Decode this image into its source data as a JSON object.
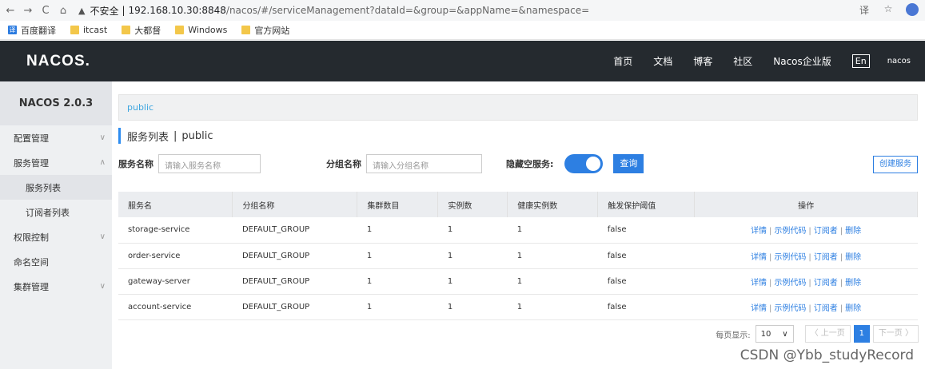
{
  "browser": {
    "nav_back": "←",
    "nav_forward": "→",
    "nav_reload": "C",
    "nav_home": "⌂",
    "warn_icon": "▲",
    "insecure": "不安全",
    "sep": "|",
    "host": "192.168.10.30:8848",
    "path": "/nacos/#/serviceManagement?dataId=&group=&appName=&namespace=",
    "translate_icon": "译",
    "star_icon": "☆"
  },
  "bookmarks": [
    {
      "label": "百度翻译",
      "icon": "translate",
      "glyph": "译"
    },
    {
      "label": "itcast",
      "icon": "folder",
      "glyph": ""
    },
    {
      "label": "大都督",
      "icon": "folder",
      "glyph": ""
    },
    {
      "label": "Windows",
      "icon": "folder",
      "glyph": ""
    },
    {
      "label": "官方网站",
      "icon": "folder",
      "glyph": ""
    }
  ],
  "topnav": {
    "logo": "NACOS.",
    "links": [
      "首页",
      "文档",
      "博客",
      "社区",
      "Nacos企业版"
    ],
    "lang": "En",
    "user": "nacos"
  },
  "sidebar": {
    "version": "NACOS 2.0.3",
    "items": [
      {
        "label": "配置管理",
        "chev": "∨"
      },
      {
        "label": "服务管理",
        "chev": "∧"
      },
      {
        "label": "权限控制",
        "chev": "∨"
      },
      {
        "label": "命名空间",
        "chev": ""
      },
      {
        "label": "集群管理",
        "chev": "∨"
      }
    ],
    "subitems": [
      "服务列表",
      "订阅者列表"
    ]
  },
  "main": {
    "namespace_tab": "public",
    "title": "服务列表",
    "title_sep": "|",
    "title_ns": "public",
    "filters": {
      "service_label": "服务名称",
      "service_placeholder": "请输入服务名称",
      "group_label": "分组名称",
      "group_placeholder": "请输入分组名称",
      "hide_empty_label": "隐藏空服务:",
      "query_btn": "查询"
    },
    "create_btn": "创建服务",
    "table": {
      "headers": [
        "服务名",
        "分组名称",
        "集群数目",
        "实例数",
        "健康实例数",
        "触发保护阈值",
        "操作"
      ],
      "rows": [
        {
          "name": "storage-service",
          "group": "DEFAULT_GROUP",
          "clusters": "1",
          "instances": "1",
          "healthy": "1",
          "threshold": "false"
        },
        {
          "name": "order-service",
          "group": "DEFAULT_GROUP",
          "clusters": "1",
          "instances": "1",
          "healthy": "1",
          "threshold": "false"
        },
        {
          "name": "gateway-server",
          "group": "DEFAULT_GROUP",
          "clusters": "1",
          "instances": "1",
          "healthy": "1",
          "threshold": "false"
        },
        {
          "name": "account-service",
          "group": "DEFAULT_GROUP",
          "clusters": "1",
          "instances": "1",
          "healthy": "1",
          "threshold": "false"
        }
      ],
      "ops": [
        "详情",
        "示例代码",
        "订阅者",
        "删除"
      ],
      "op_sep": "|"
    },
    "pager": {
      "per_page_label": "每页显示:",
      "per_page": "10",
      "dropdown": "∨",
      "prev": "〈 上一页",
      "current": "1",
      "next": "下一页 〉"
    }
  },
  "watermark": "CSDN @Ybb_studyRecord"
}
